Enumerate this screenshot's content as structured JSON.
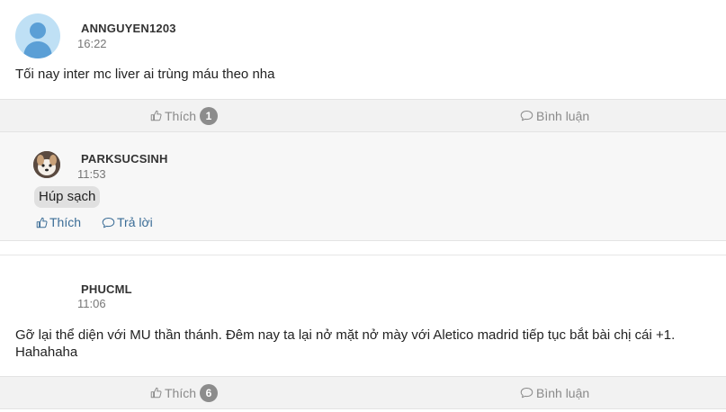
{
  "post1": {
    "author": "ANNGUYEN1203",
    "time": "16:22",
    "content": "Tối nay inter mc liver ai trùng máu theo nha",
    "like_label": "Thích",
    "like_count": "1",
    "comment_label": "Bình luận"
  },
  "reply1": {
    "author": "PARKSUCSINH",
    "time": "11:53",
    "content": "Húp sạch",
    "like_label": "Thích",
    "reply_label": "Trả lời"
  },
  "post2": {
    "author": "PHUCML",
    "time": "11:06",
    "content_line1": "Gỡ lại thể diện với MU thần thánh. Đêm nay ta lại nở mặt nở mày với Aletico madrid tiếp tục bắt bài chị cái +1.",
    "content_line2": "Hahahaha",
    "like_label": "Thích",
    "like_count": "6",
    "comment_label": "Bình luận"
  },
  "icons": {
    "like": "thumbs-up-icon",
    "comment": "speech-bubble-icon",
    "reply": "speech-bubble-icon",
    "avatar": "default-user-avatar"
  },
  "colors": {
    "action_gray": "#8a8a8a",
    "reply_link_blue": "#3a6c96",
    "avatar_bg": "#bfe0f5",
    "avatar_fg": "#5b9fd6"
  }
}
